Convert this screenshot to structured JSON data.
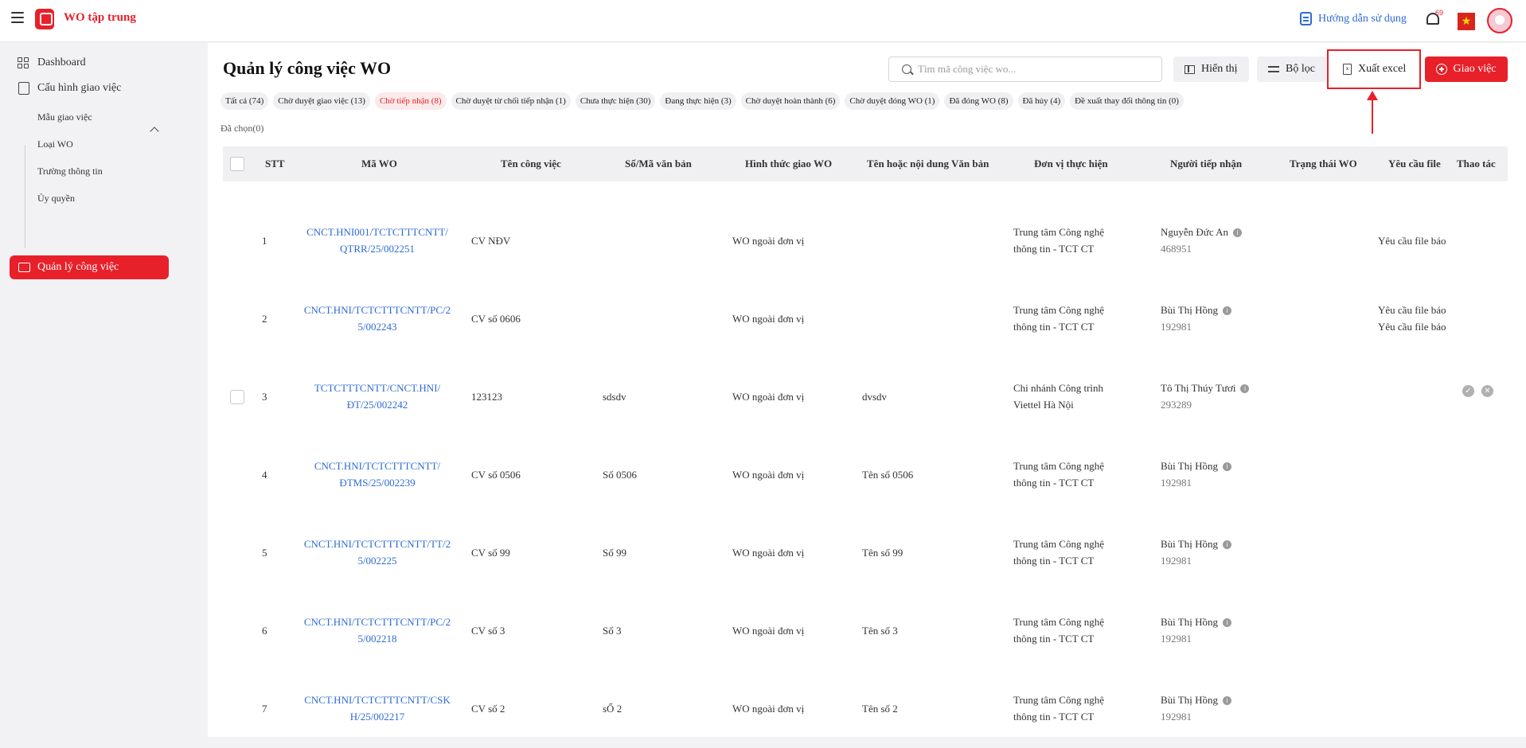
{
  "app": {
    "title": "WO tập trung"
  },
  "header": {
    "guide_label": "Hướng dẫn sử dụng",
    "notification_count": "69"
  },
  "sidebar": {
    "items": [
      {
        "label": "Dashboard"
      },
      {
        "label": "Cấu hình giao việc"
      },
      {
        "label": "Mẫu giao việc"
      },
      {
        "label": "Loại WO"
      },
      {
        "label": "Trường thông tin"
      },
      {
        "label": "Ủy quyền"
      },
      {
        "label": "Quản lý công việc"
      }
    ]
  },
  "page": {
    "title": "Quản lý công việc WO",
    "search_placeholder": "Tìm mã công việc wo...",
    "buttons": {
      "display": "Hiển thị",
      "filter": "Bộ lọc",
      "export": "Xuất excel",
      "assign": "Giao việc"
    },
    "selected_label": "Đã chọn(0)"
  },
  "status_tabs": [
    "Tất cả (74)",
    "Chờ duyệt giao việc (13)",
    "Chờ tiếp nhận (8)",
    "Chờ duyệt từ chối tiếp nhận (1)",
    "Chưa thực hiện (30)",
    "Đang thực hiện (3)",
    "Chờ duyệt hoàn thành (6)",
    "Chờ duyệt đóng WO (1)",
    "Đã đóng WO (8)",
    "Đã hủy (4)",
    "Đề xuất thay đổi thông tin (0)"
  ],
  "table": {
    "columns": [
      "STT",
      "Mã WO",
      "Tên công việc",
      "Số/Mã văn bản",
      "Hình thức giao WO",
      "Tên hoặc nội dung Văn bản",
      "Đơn vị thực hiện",
      "Người tiếp nhận",
      "Trạng thái WO",
      "Yêu cầu file",
      "Thao tác"
    ],
    "rows": [
      {
        "stt": "1",
        "wo_l1": "CNCT.HNI001/TCTCTTTCNTT/",
        "wo_l2": "QTRR/25/002251",
        "name": "CV NĐV",
        "doc_no": "",
        "form": "WO ngoài đơn vị",
        "doc_name": "",
        "unit_l1": "Trung tâm Công nghệ",
        "unit_l2": "thông tin - TCT CT",
        "receiver": "Nguyễn Đức An",
        "receiver_code": "468951",
        "req1": "Yêu cầu file báo",
        "req2": ""
      },
      {
        "stt": "2",
        "wo_l1": "CNCT.HNI/TCTCTTTCNTT/PC/2",
        "wo_l2": "5/002243",
        "name": "CV số 0606",
        "doc_no": "",
        "form": "WO ngoài đơn vị",
        "doc_name": "",
        "unit_l1": "Trung tâm Công nghệ",
        "unit_l2": "thông tin - TCT CT",
        "receiver": "Bùi Thị Hồng",
        "receiver_code": "192981",
        "req1": "Yêu cầu file báo",
        "req2": "Yêu cầu file báo"
      },
      {
        "stt": "3",
        "wo_l1": "TCTCTTTCNTT/CNCT.HNI/",
        "wo_l2": "ĐT/25/002242",
        "name": "123123",
        "doc_no": "sdsdv",
        "form": "WO ngoài đơn vị",
        "doc_name": "dvsdv",
        "unit_l1": "Chi nhánh Công trình",
        "unit_l2": "Viettel Hà Nội",
        "receiver": "Tô Thị Thúy Tươi",
        "receiver_code": "293289",
        "req1": "",
        "req2": ""
      },
      {
        "stt": "4",
        "wo_l1": "CNCT.HNI/TCTCTTTCNTT/",
        "wo_l2": "ĐTMS/25/002239",
        "name": "CV số 0506",
        "doc_no": "Số 0506",
        "form": "WO ngoài đơn vị",
        "doc_name": "Tên số 0506",
        "unit_l1": "Trung tâm Công nghệ",
        "unit_l2": "thông tin - TCT CT",
        "receiver": "Bùi Thị Hồng",
        "receiver_code": "192981",
        "req1": "",
        "req2": ""
      },
      {
        "stt": "5",
        "wo_l1": "CNCT.HNI/TCTCTTTCNTT/TT/2",
        "wo_l2": "5/002225",
        "name": "CV số 99",
        "doc_no": "Số 99",
        "form": "WO ngoài đơn vị",
        "doc_name": "Tên số 99",
        "unit_l1": "Trung tâm Công nghệ",
        "unit_l2": "thông tin - TCT CT",
        "receiver": "Bùi Thị Hồng",
        "receiver_code": "192981",
        "req1": "",
        "req2": ""
      },
      {
        "stt": "6",
        "wo_l1": "CNCT.HNI/TCTCTTTCNTT/PC/2",
        "wo_l2": "5/002218",
        "name": "CV số 3",
        "doc_no": "Số 3",
        "form": "WO ngoài đơn vị",
        "doc_name": "Tên số 3",
        "unit_l1": "Trung tâm Công nghệ",
        "unit_l2": "thông tin - TCT CT",
        "receiver": "Bùi Thị Hồng",
        "receiver_code": "192981",
        "req1": "",
        "req2": ""
      },
      {
        "stt": "7",
        "wo_l1": "CNCT.HNI/TCTCTTTCNTT/CSK",
        "wo_l2": "H/25/002217",
        "name": "CV số 2",
        "doc_no": "sỐ 2",
        "form": "WO ngoài đơn vị",
        "doc_name": "Tên số 2",
        "unit_l1": "Trung tâm Công nghệ",
        "unit_l2": "thông tin - TCT CT",
        "receiver": "Bùi Thị Hồng",
        "receiver_code": "192981",
        "req1": "",
        "req2": ""
      }
    ]
  },
  "colors": {
    "brand": "#e8202a",
    "link": "#2e6bd6"
  }
}
